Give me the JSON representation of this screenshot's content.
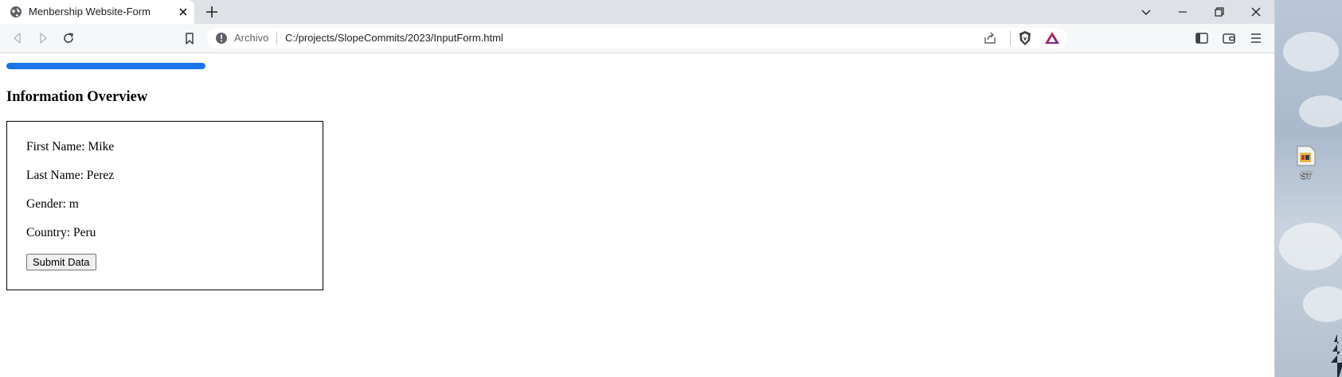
{
  "browser": {
    "tab": {
      "title": "Menbership Website-Form",
      "favicon": "globe-icon",
      "close_icon": "close-icon"
    },
    "new_tab_icon": "plus-icon",
    "window_controls": [
      "chevron-down-icon",
      "minimize-icon",
      "restore-icon",
      "close-icon"
    ],
    "nav": {
      "back_icon": "back-arrow-icon",
      "forward_icon": "forward-arrow-icon",
      "reload_icon": "reload-icon",
      "bookmark_icon": "bookmark-icon"
    },
    "address_bar": {
      "security_label": "Archivo",
      "security_icon": "info-icon",
      "url": "C:/projects/SlopeCommits/2023/InputForm.html",
      "share_icon": "share-icon",
      "extensions": [
        "brave-shield-icon",
        "brave-rewards-icon"
      ]
    },
    "toolbar_right_icons": [
      "sidebar-icon",
      "wallet-icon",
      "menu-icon"
    ],
    "accent_color": "#1a73e8"
  },
  "page": {
    "progress": {
      "percent": 100,
      "color": "#1a73e8"
    },
    "heading": "Information Overview",
    "fields": [
      {
        "label": "First Name: Mike"
      },
      {
        "label": "Last Name: Perez"
      },
      {
        "label": "Gender: m"
      },
      {
        "label": "Country: Peru"
      }
    ],
    "submit_label": "Submit Data"
  },
  "desktop": {
    "icon_label": "ST",
    "icon": "file-shortcut-icon"
  }
}
